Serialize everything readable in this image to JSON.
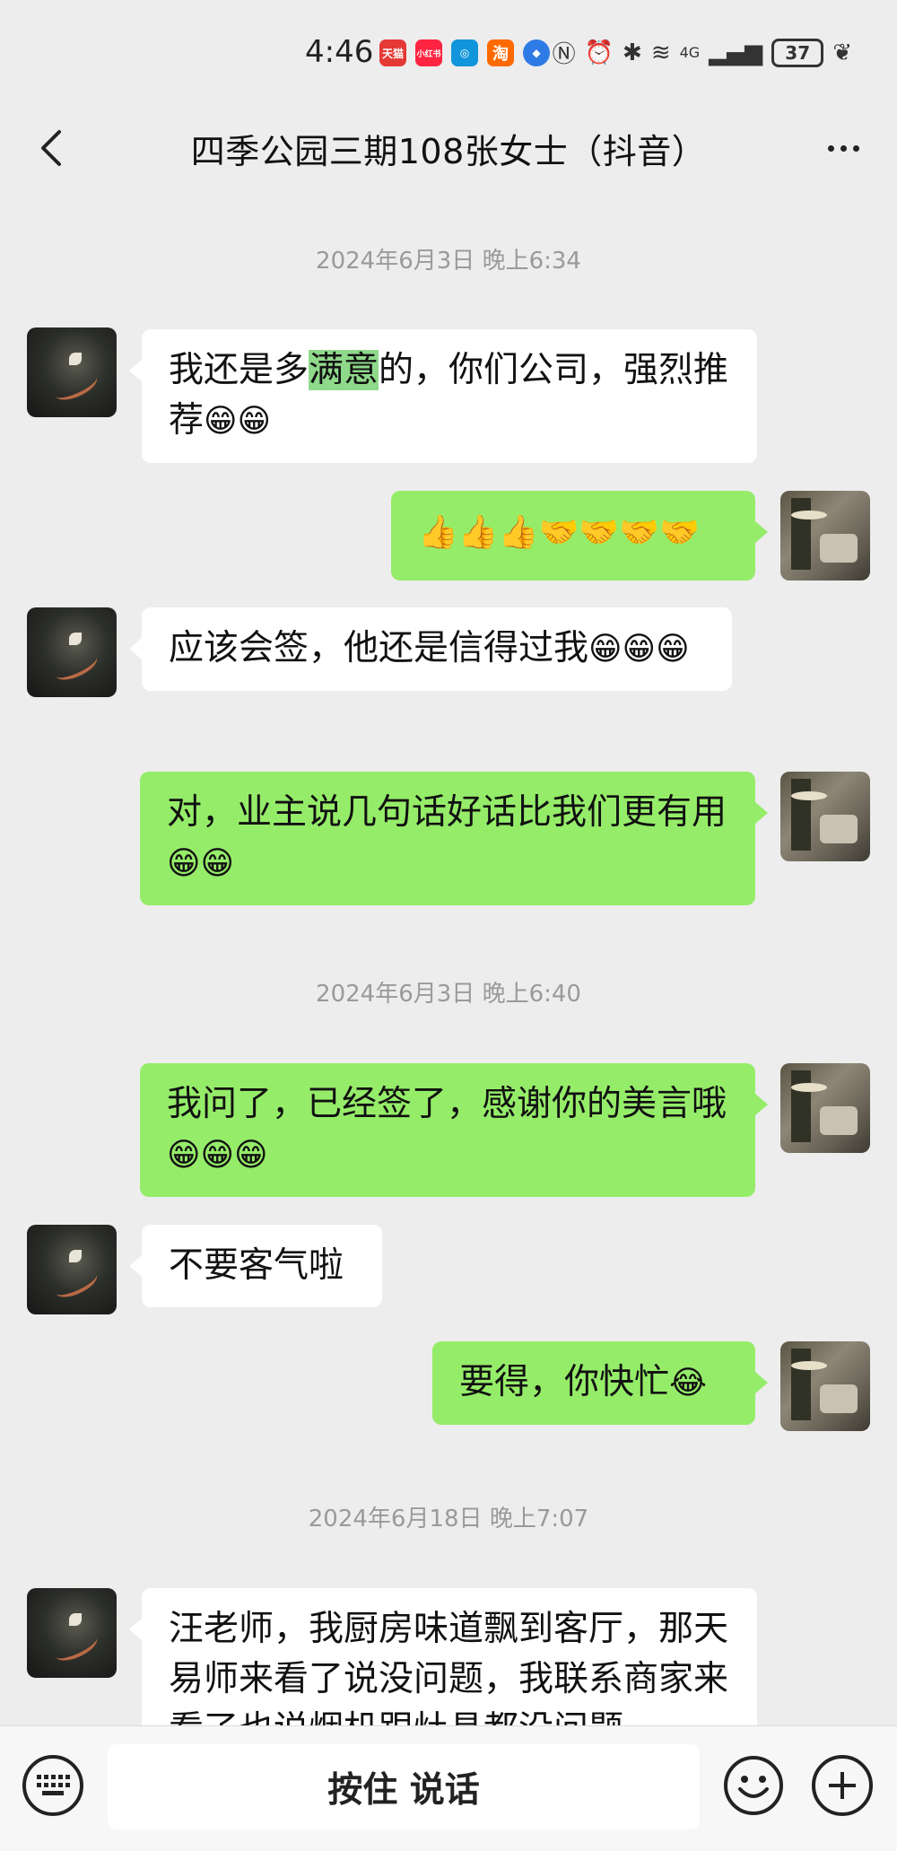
{
  "status_bar": {
    "time": "4:46",
    "apps": [
      {
        "name": "tmall-app-icon",
        "label": "天猫",
        "color": "#e53935"
      },
      {
        "name": "redbook-app-icon",
        "label": "小红书",
        "color": "#ff2442"
      },
      {
        "name": "alipay-app-icon",
        "label": "",
        "color": "#1296db"
      },
      {
        "name": "taobao-app-icon",
        "label": "淘",
        "color": "#ff6a00"
      },
      {
        "name": "browser-app-icon",
        "label": "",
        "color": "#2f7be5"
      }
    ],
    "network": "4G",
    "battery": "37"
  },
  "nav": {
    "title": "四季公园三期108张女士（抖音）"
  },
  "chat": {
    "timestamps": [
      "2024年6月3日 晚上6:34",
      "2024年6月3日 晚上6:40",
      "2024年6月18日 晚上7:07"
    ],
    "messages": [
      {
        "side": "left",
        "pre": "我还是多",
        "highlight": "满意",
        "post": "的，你们公司，强烈推荐",
        "emoji": "😁😁"
      },
      {
        "side": "right",
        "text": "",
        "emoji": "👍👍👍🤝🤝🤝🤝"
      },
      {
        "side": "left",
        "text": "应该会签，他还是信得过我",
        "emoji": "😁😁😁"
      },
      {
        "side": "right",
        "text": "对，业主说几句话好话比我们更有用",
        "emoji": "😁😁"
      },
      {
        "side": "right",
        "text": "我问了，已经签了，感谢你的美言哦",
        "emoji": "😁😁😁"
      },
      {
        "side": "left",
        "text": "不要客气啦",
        "emoji": ""
      },
      {
        "side": "right",
        "text": "要得，你快忙",
        "emoji": "😂"
      },
      {
        "side": "left",
        "text": "汪老师，我厨房味道飘到客厅，那天易师来看了说没问题，我联系商家来看了也说烟机跟灶具都没问题",
        "emoji": ""
      }
    ]
  },
  "input_bar": {
    "hold_to_talk_label": "按住 说话"
  },
  "colors": {
    "background": "#ededed",
    "bubble_self": "#95ec69",
    "bubble_other": "#ffffff",
    "timestamp": "#9a9a9a"
  }
}
